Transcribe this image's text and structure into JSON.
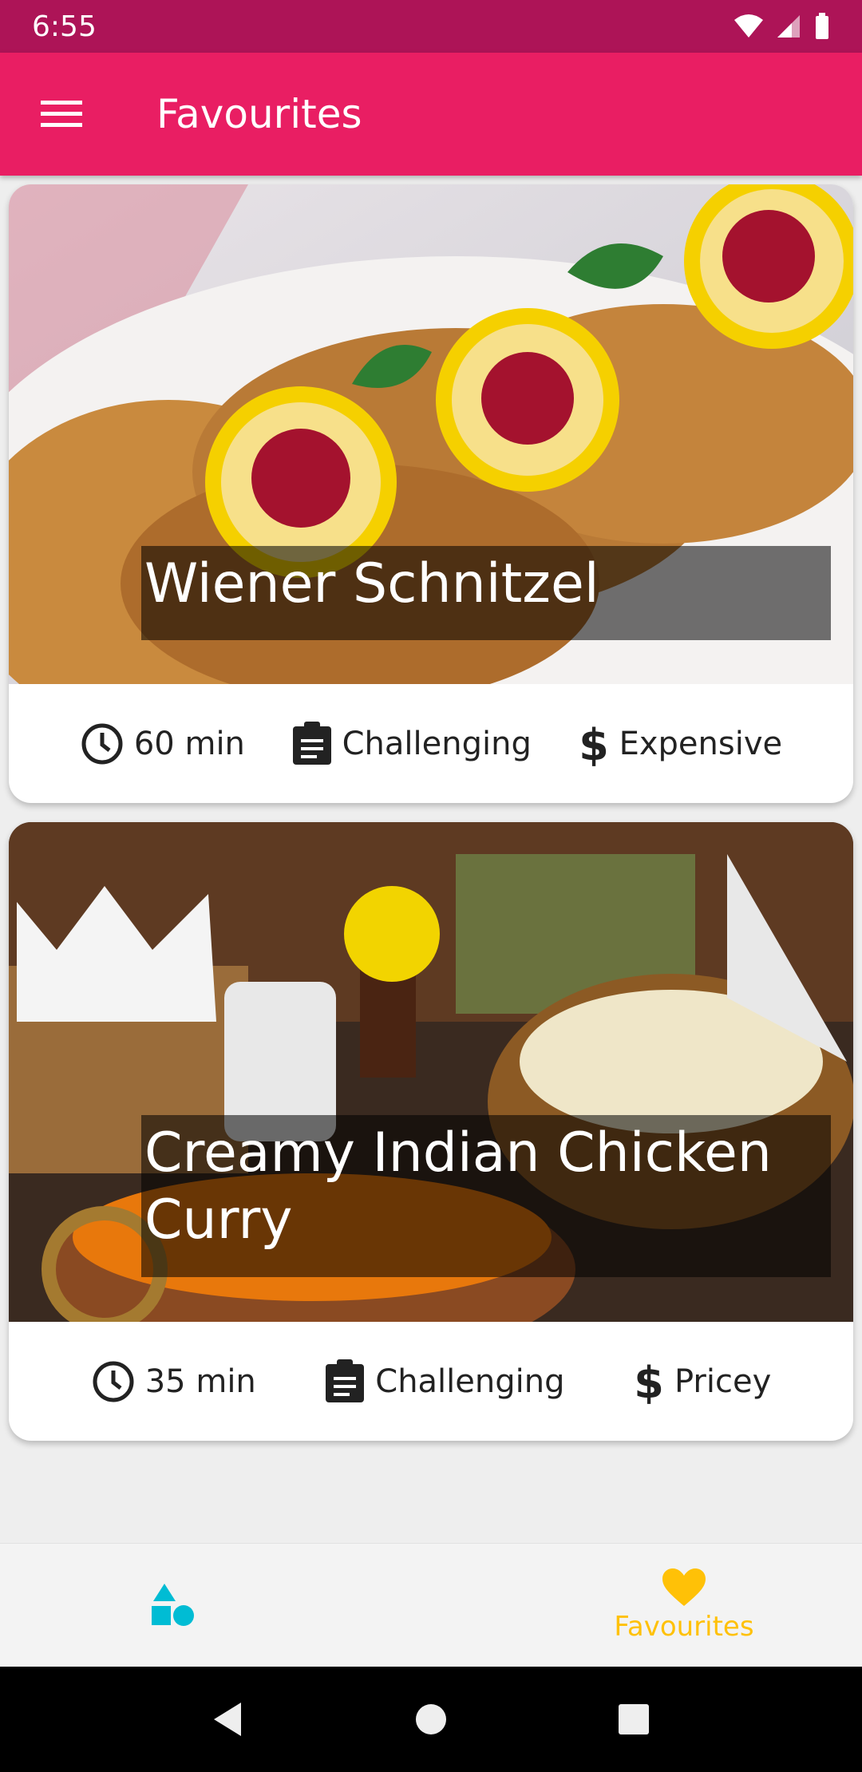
{
  "status_bar": {
    "time": "6:55"
  },
  "app_bar": {
    "title": "Favourites",
    "menu_icon": "menu-icon"
  },
  "meals": [
    {
      "title": "Wiener Schnitzel",
      "duration": "60 min",
      "complexity": "Challenging",
      "affordability": "Expensive"
    },
    {
      "title": "Creamy Indian Chicken Curry",
      "duration": "35 min",
      "complexity": "Challenging",
      "affordability": "Pricey"
    }
  ],
  "bottom_nav": {
    "categories_icon": "categories-icon",
    "favourites_label": "Favourites",
    "active_color": "#ffc107",
    "inactive_color": "#00bcd4"
  },
  "colors": {
    "primary": "#e91e63",
    "status_bar": "#ad1457"
  }
}
